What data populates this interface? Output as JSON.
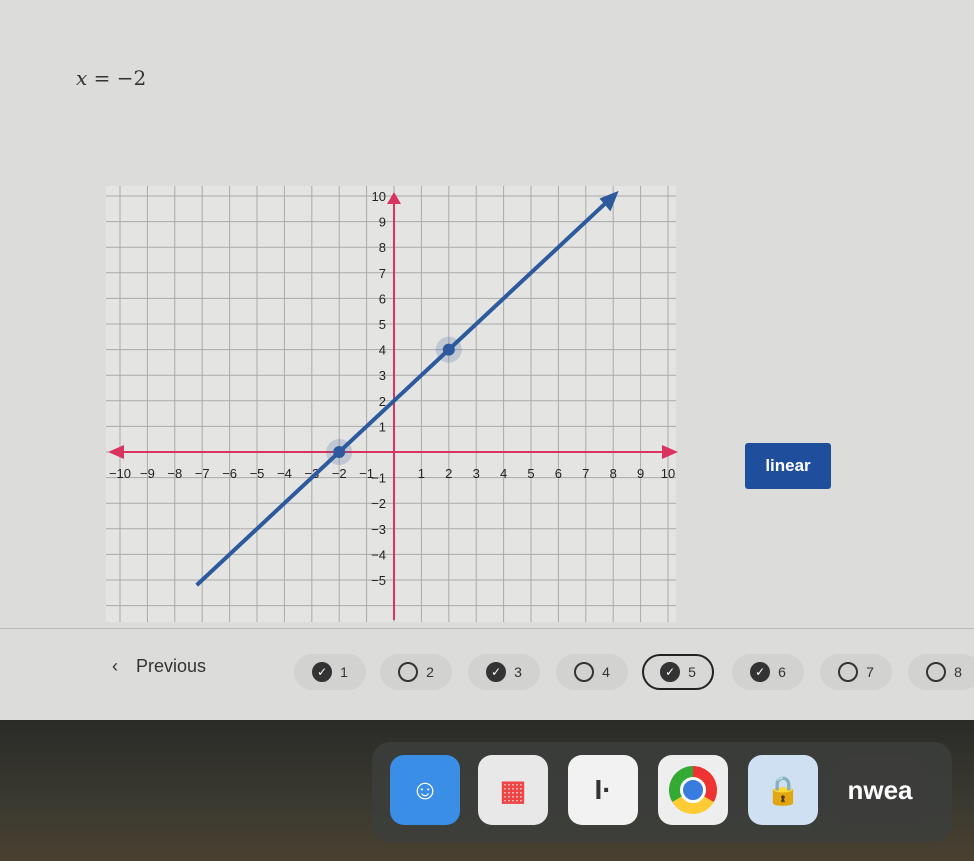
{
  "question": {
    "formula_var": "x",
    "formula_rest": " = −2"
  },
  "graph": {
    "x_range": [
      -10,
      10
    ],
    "y_range": [
      -5,
      10
    ],
    "x_ticks": [
      -10,
      -9,
      -8,
      -7,
      -6,
      -5,
      -4,
      -3,
      -2,
      -1,
      1,
      2,
      3,
      4,
      5,
      6,
      7,
      8,
      9,
      10
    ],
    "y_ticks": [
      -5,
      -4,
      -3,
      -2,
      -1,
      1,
      2,
      3,
      4,
      5,
      6,
      7,
      8,
      9,
      10
    ],
    "line": {
      "slope": 1,
      "intercept": 2
    },
    "points": [
      [
        -2,
        0
      ],
      [
        2,
        4
      ]
    ],
    "axis_color": "#d8345f",
    "line_color": "#2d5a9c"
  },
  "linear_button": "linear",
  "nav": {
    "previous": "Previous",
    "questions": [
      {
        "label": "1",
        "done": true
      },
      {
        "label": "2",
        "done": false
      },
      {
        "label": "3",
        "done": true
      },
      {
        "label": "4",
        "done": false
      },
      {
        "label": "5",
        "done": true,
        "current": true
      },
      {
        "label": "6",
        "done": true
      },
      {
        "label": "7",
        "done": false
      },
      {
        "label": "8",
        "done": false
      }
    ]
  },
  "dock": {
    "apps": [
      "finder",
      "launchpad",
      "app",
      "chrome",
      "notes-lock",
      "nwea"
    ],
    "nwea_label": "nwea"
  }
}
